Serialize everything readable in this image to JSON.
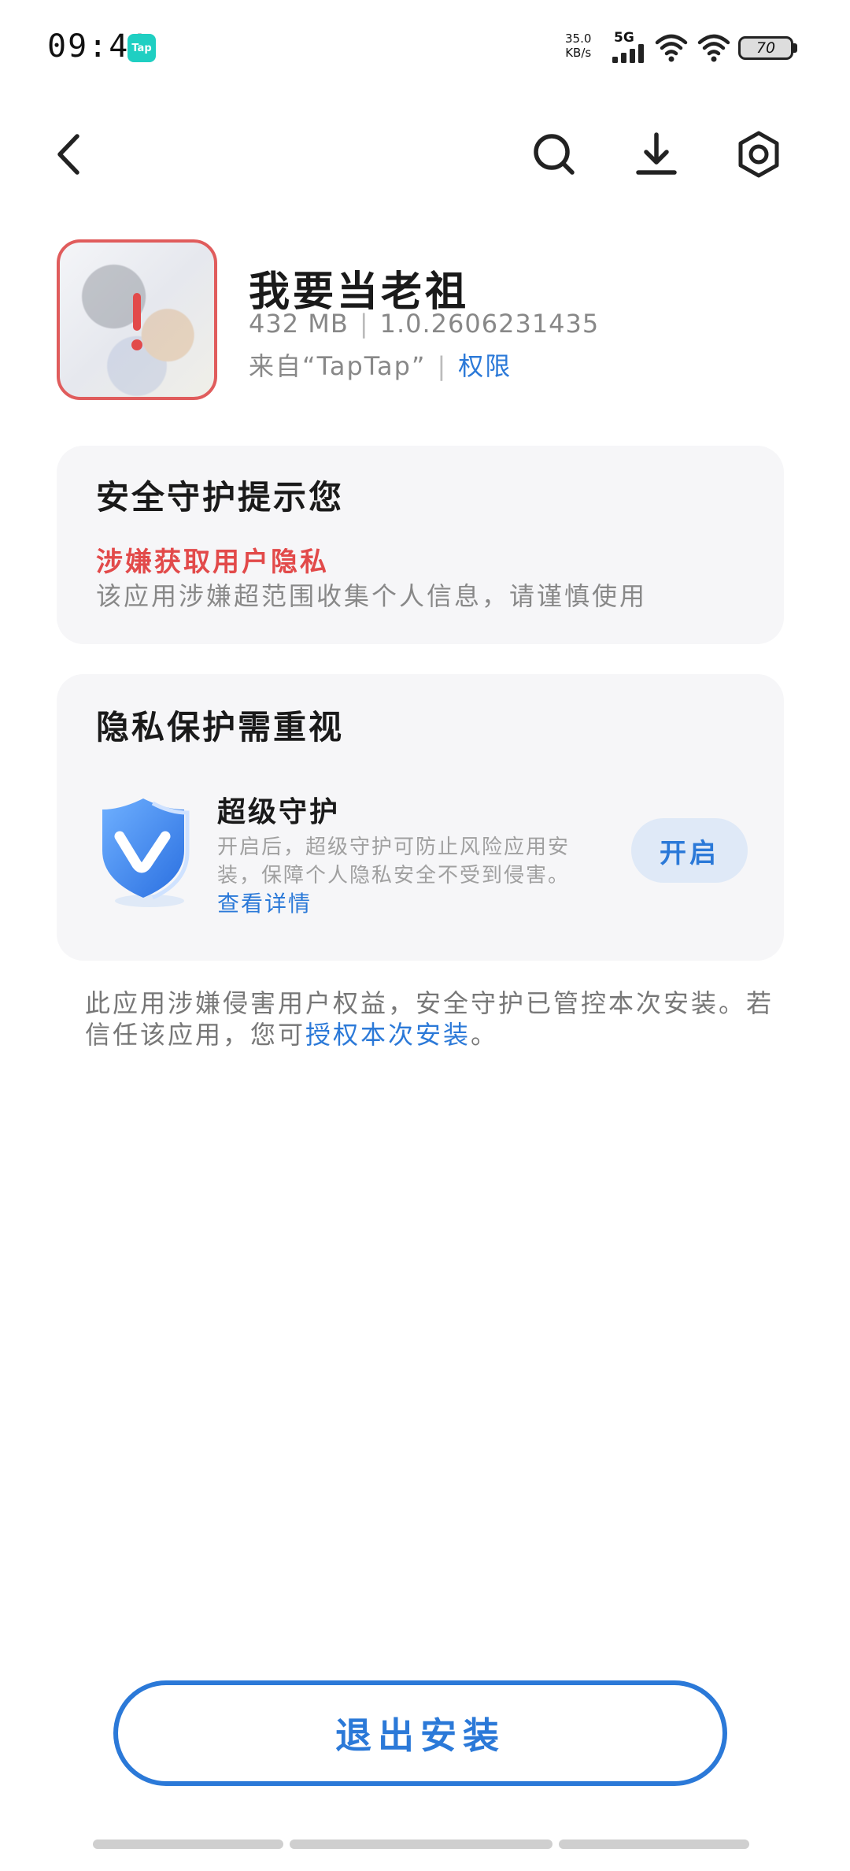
{
  "status_bar": {
    "time": "09:41",
    "app_badge": "Tap",
    "net_speed_value": "35.0",
    "net_speed_unit": "KB/s",
    "network": "5G",
    "battery": "70"
  },
  "nav": {
    "back_icon": "chevron-left-icon",
    "search_icon": "search-icon",
    "download_icon": "download-icon",
    "settings_icon": "hexagon-settings-icon"
  },
  "app": {
    "name": "我要当老祖",
    "size": "432 MB",
    "version": "1.0.2606231435",
    "source": "来自“TapTap”",
    "permissions_label": "权限"
  },
  "security_card": {
    "title": "安全守护提示您",
    "warning_title": "涉嫌获取用户隐私",
    "warning_desc": "该应用涉嫌超范围收集个人信息，请谨慎使用"
  },
  "privacy_card": {
    "title": "隐私保护需重视",
    "feature_title": "超级守护",
    "feature_desc": "开启后，超级守护可防止风险应用安装，保障个人隐私安全不受到侵害。",
    "feature_link": "查看详情",
    "enable_button": "开启"
  },
  "notice": {
    "text_part1": "此应用涉嫌侵害用户权益，安全守护已管控本次安装。若信任该应用，您可",
    "link": "授权本次安装",
    "text_part2": "。"
  },
  "exit_button": "退出安装",
  "colors": {
    "accent": "#2b79d8",
    "warning": "#e24a4a",
    "card_bg": "#f6f6f8"
  }
}
